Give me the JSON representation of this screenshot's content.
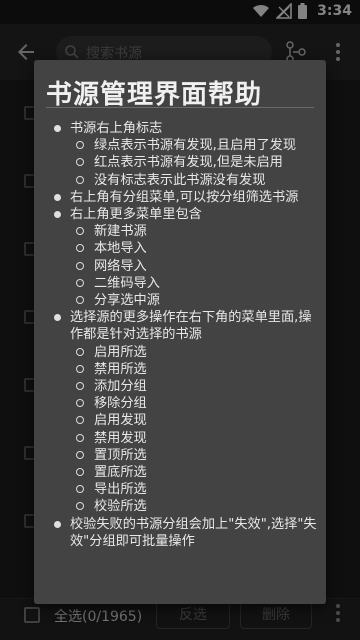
{
  "status": {
    "time": "3:34"
  },
  "toolbar": {
    "search_placeholder": "搜索书源"
  },
  "bottom": {
    "select_all": "全选(0/1965)",
    "invert": "反选",
    "delete": "删除"
  },
  "dialog": {
    "title": "书源管理界面帮助",
    "items": [
      {
        "text": "书源右上角标志",
        "sub": [
          "绿点表示书源有发现,且启用了发现",
          "红点表示书源有发现,但是未启用",
          "没有标志表示此书源没有发现"
        ]
      },
      {
        "text": "右上角有分组菜单,可以按分组筛选书源",
        "sub": []
      },
      {
        "text": "右上角更多菜单里包含",
        "sub": [
          "新建书源",
          "本地导入",
          "网络导入",
          "二维码导入",
          "分享选中源"
        ]
      },
      {
        "text": "选择源的更多操作在右下角的菜单里面,操作都是针对选择的书源",
        "sub": [
          "启用所选",
          "禁用所选",
          "添加分组",
          "移除分组",
          "启用发现",
          "禁用发现",
          "置顶所选",
          "置底所选",
          "导出所选",
          "校验所选"
        ]
      },
      {
        "text": "校验失败的书源分组会加上\"失效\",选择\"失效\"分组即可批量操作",
        "sub": []
      }
    ]
  }
}
